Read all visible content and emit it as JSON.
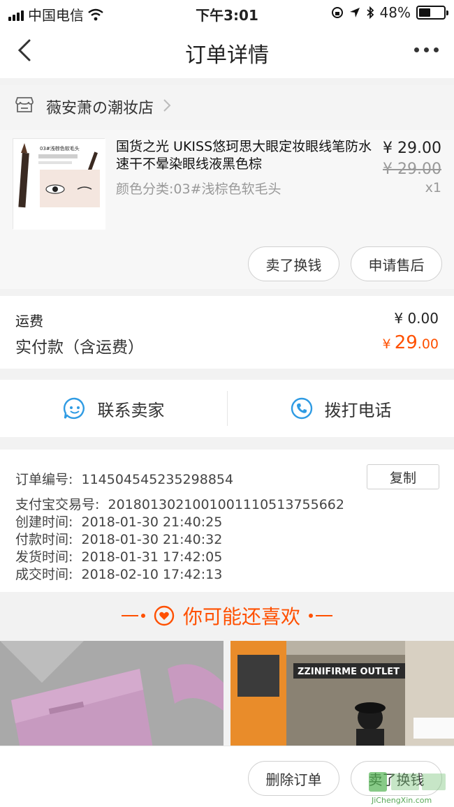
{
  "status_bar": {
    "carrier": "中国电信",
    "time": "下午3:01",
    "battery": "48%",
    "battery_level": 0.48
  },
  "nav": {
    "title": "订单详情"
  },
  "shop": {
    "name": "薇安萧の潮妆店"
  },
  "product": {
    "title": "国货之光 UKISS悠珂思大眼定妆眼线笔防水速干不晕染眼线液黑色棕",
    "spec": "颜色分类:03#浅棕色软毛头",
    "price": "¥ 29.00",
    "original_price": "¥ 29.00",
    "quantity": "x1",
    "thumb_caption": "03#浅棕色软毛头",
    "actions": [
      "卖了换钱",
      "申请售后"
    ]
  },
  "fees": {
    "shipping_label": "运费",
    "shipping_value": "¥ 0.00",
    "paid_label": "实付款（含运费）",
    "paid_currency": "¥",
    "paid_int": "29",
    "paid_dec": ".00"
  },
  "contact": {
    "seller": "联系卖家",
    "phone": "拨打电话"
  },
  "order": {
    "number_label": "订单编号:",
    "number": "114504545235298854",
    "copy": "复制",
    "alipay_label": "支付宝交易号:",
    "alipay": "2018013021001001110513755662",
    "created_label": "创建时间:",
    "created": "2018-01-30 21:40:25",
    "paid_label": "付款时间:",
    "paid": "2018-01-30 21:40:32",
    "shipped_label": "发货时间:",
    "shipped": "2018-01-31 17:42:05",
    "done_label": "成交时间:",
    "done": "2018-02-10 17:42:13"
  },
  "recommend": {
    "title": "你可能还喜欢",
    "sign_text": "ZZINIFIRME OUTLET"
  },
  "bottom": {
    "delete": "删除订单",
    "sell": "卖了换钱"
  },
  "watermark": {
    "text": "JiChengXin.com"
  },
  "colors": {
    "accent": "#ff5000",
    "icon_blue": "#2f9be3"
  }
}
